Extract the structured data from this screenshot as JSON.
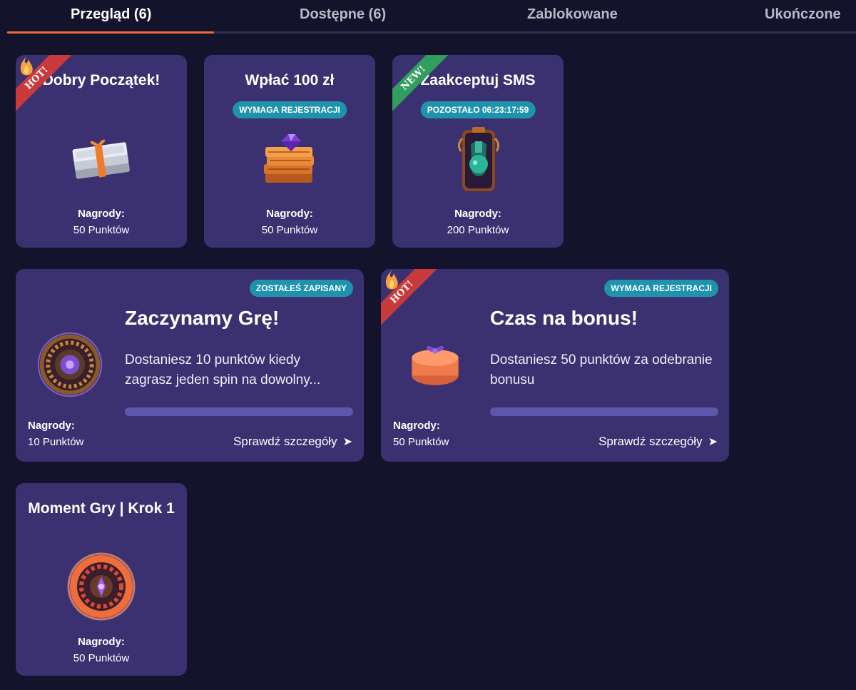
{
  "tabs": [
    {
      "label": "Przegląd (6)",
      "active": true
    },
    {
      "label": "Dostępne (6)",
      "active": false
    },
    {
      "label": "Zablokowane",
      "active": false
    },
    {
      "label": "Ukończone",
      "active": false
    }
  ],
  "cards": [
    {
      "title": "Dobry Początek!",
      "ribbon": "HOT!",
      "image": "money-stack-icon",
      "rewards_label": "Nagrody:",
      "rewards_value": "50 Punktów"
    },
    {
      "title": "Wpłać 100 zł",
      "pill": "WYMAGA REJESTRACJI",
      "image": "gem-coins-icon",
      "rewards_label": "Nagrody:",
      "rewards_value": "50 Punktów"
    },
    {
      "title": "Zaakceptuj SMS",
      "ribbon": "NEW!",
      "pill": "POZOSTAŁO 06:23:17:59",
      "image": "potion-phone-icon",
      "rewards_label": "Nagrody:",
      "rewards_value": "200 Punktów"
    },
    {
      "title": "Zaczynamy Grę!",
      "pill": "ZOSTAŁEŚ ZAPISANY",
      "image": "roulette-icon",
      "description": "Dostaniesz 10 punktów kiedy zagrasz jeden spin na dowolny...",
      "progress": 0,
      "rewards_label": "Nagrody:",
      "rewards_value": "10 Punktów",
      "details_label": "Sprawdź szczegóły"
    },
    {
      "title": "Czas na bonus!",
      "ribbon": "HOT!",
      "pill": "WYMAGA REJESTRACJI",
      "image": "gift-box-icon",
      "description": "Dostaniesz 50 punktów za odebranie bonusu",
      "progress": 0,
      "rewards_label": "Nagrody:",
      "rewards_value": "50 Punktów",
      "details_label": "Sprawdź szczegóły"
    },
    {
      "title": "Moment Gry | Krok 1",
      "image": "roulette-wheel-icon",
      "rewards_label": "Nagrody:",
      "rewards_value": "50 Punktów"
    }
  ],
  "colors": {
    "accent": "#ee6d3a",
    "pill": "#1f93ad",
    "card": "#3b3170",
    "background": "#13132b",
    "hot": "#c93a3c",
    "new": "#2f9e5e"
  }
}
